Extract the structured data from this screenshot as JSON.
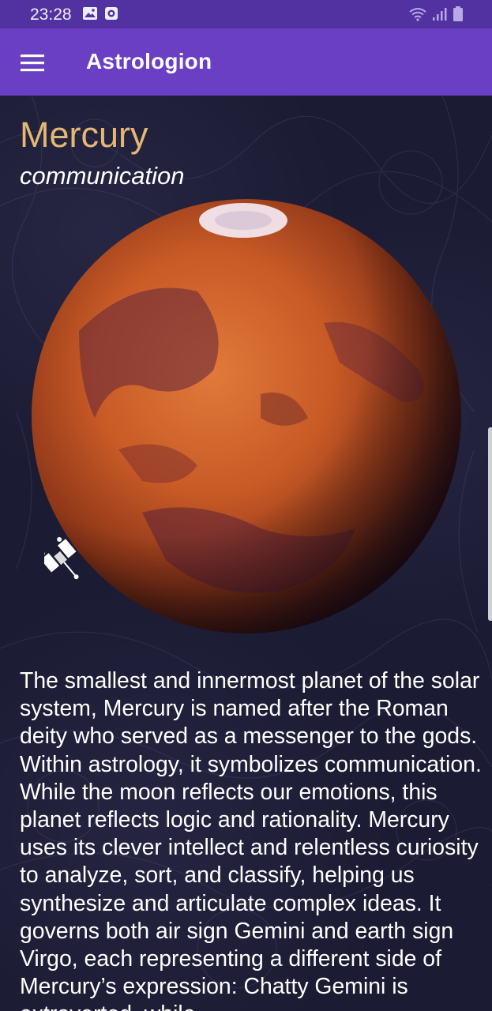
{
  "status_bar": {
    "time": "23:28",
    "left_icons": [
      "image-icon",
      "screen-record-icon"
    ],
    "right_icons": [
      "wifi-icon",
      "signal-icon",
      "battery-icon"
    ]
  },
  "app_bar": {
    "title": "Astrologion",
    "menu_icon": "hamburger-menu-icon"
  },
  "planet": {
    "name": "Mercury",
    "keyword": "communication",
    "image_icon": "planet-image",
    "satellite_icon": "satellite-icon",
    "description": "The smallest and innermost planet of the solar system, Mercury is named after the Roman deity who served as a messenger to the gods. Within astrology, it symbolizes communication. While the moon reflects our emotions, this planet reflects logic and rationality. Mercury uses its clever intellect and relentless curiosity to analyze, sort, and classify, helping us synthesize and articulate complex ideas. It governs both air sign Gemini and earth sign Virgo, each representing a different side of Mercury’s expression: Chatty Gemini is extroverted, while"
  },
  "colors": {
    "status_bar": "#5232a0",
    "app_bar": "#6a3fc4",
    "background": "#1b1b33",
    "planet_name": "#e4b774",
    "text": "#ffffff"
  }
}
